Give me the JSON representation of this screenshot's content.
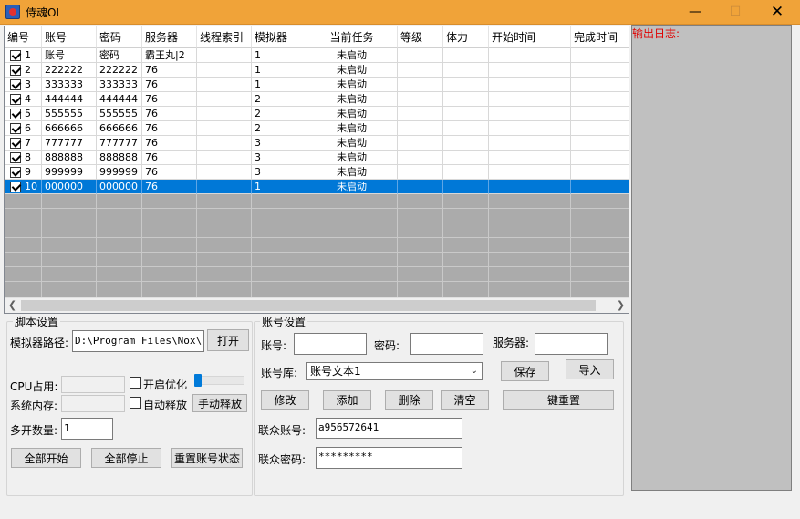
{
  "window": {
    "title": "侍魂OL"
  },
  "grid": {
    "columns": [
      "编号",
      "账号",
      "密码",
      "服务器",
      "线程索引",
      "模拟器",
      "当前任务",
      "等级",
      "体力",
      "开始时间",
      "完成时间"
    ],
    "rows": [
      {
        "num": "1",
        "account": "账号",
        "password": "密码",
        "server": "霸王丸|2",
        "thread": "",
        "emulator": "1",
        "task": "未启动"
      },
      {
        "num": "2",
        "account": "222222",
        "password": "222222",
        "server": "76",
        "thread": "",
        "emulator": "1",
        "task": "未启动"
      },
      {
        "num": "3",
        "account": "333333",
        "password": "333333",
        "server": "76",
        "thread": "",
        "emulator": "1",
        "task": "未启动"
      },
      {
        "num": "4",
        "account": "444444",
        "password": "444444",
        "server": "76",
        "thread": "",
        "emulator": "2",
        "task": "未启动"
      },
      {
        "num": "5",
        "account": "555555",
        "password": "555555",
        "server": "76",
        "thread": "",
        "emulator": "2",
        "task": "未启动"
      },
      {
        "num": "6",
        "account": "666666",
        "password": "666666",
        "server": "76",
        "thread": "",
        "emulator": "2",
        "task": "未启动"
      },
      {
        "num": "7",
        "account": "777777",
        "password": "777777",
        "server": "76",
        "thread": "",
        "emulator": "3",
        "task": "未启动"
      },
      {
        "num": "8",
        "account": "888888",
        "password": "888888",
        "server": "76",
        "thread": "",
        "emulator": "3",
        "task": "未启动"
      },
      {
        "num": "9",
        "account": "999999",
        "password": "999999",
        "server": "76",
        "thread": "",
        "emulator": "3",
        "task": "未启动"
      },
      {
        "num": "10",
        "account": "000000",
        "password": "000000",
        "server": "76",
        "thread": "",
        "emulator": "1",
        "task": "未启动"
      }
    ]
  },
  "log": {
    "label": "输出日志:"
  },
  "script_settings": {
    "title": "脚本设置",
    "emulator_path_label": "模拟器路径:",
    "emulator_path_value": "D:\\Program Files\\Nox\\bin",
    "open_button": "打开",
    "cpu_label": "CPU占用:",
    "memory_label": "系统内存:",
    "optimize_label": "开启优化",
    "auto_release_label": "自动释放",
    "manual_release_button": "手动释放",
    "multi_count_label": "多开数量:",
    "multi_count_value": "1",
    "start_all_button": "全部开始",
    "stop_all_button": "全部停止",
    "reset_status_button": "重置账号状态"
  },
  "account_settings": {
    "title": "账号设置",
    "account_label": "账号:",
    "password_label": "密码:",
    "server_label": "服务器:",
    "library_label": "账号库:",
    "library_value": "账号文本1",
    "save_button": "保存",
    "import_button": "导入",
    "edit_button": "修改",
    "add_button": "添加",
    "delete_button": "删除",
    "clear_button": "清空",
    "reset_button": "一键重置",
    "lianzhong_account_label": "联众账号:",
    "lianzhong_account_value": "a956572641",
    "lianzhong_password_label": "联众密码:",
    "lianzhong_password_value": "*********"
  },
  "colors": {
    "titlebar": "#f0a339",
    "selection": "#0078d7",
    "log_text": "#e00000",
    "log_bg": "#c0c0c0"
  }
}
